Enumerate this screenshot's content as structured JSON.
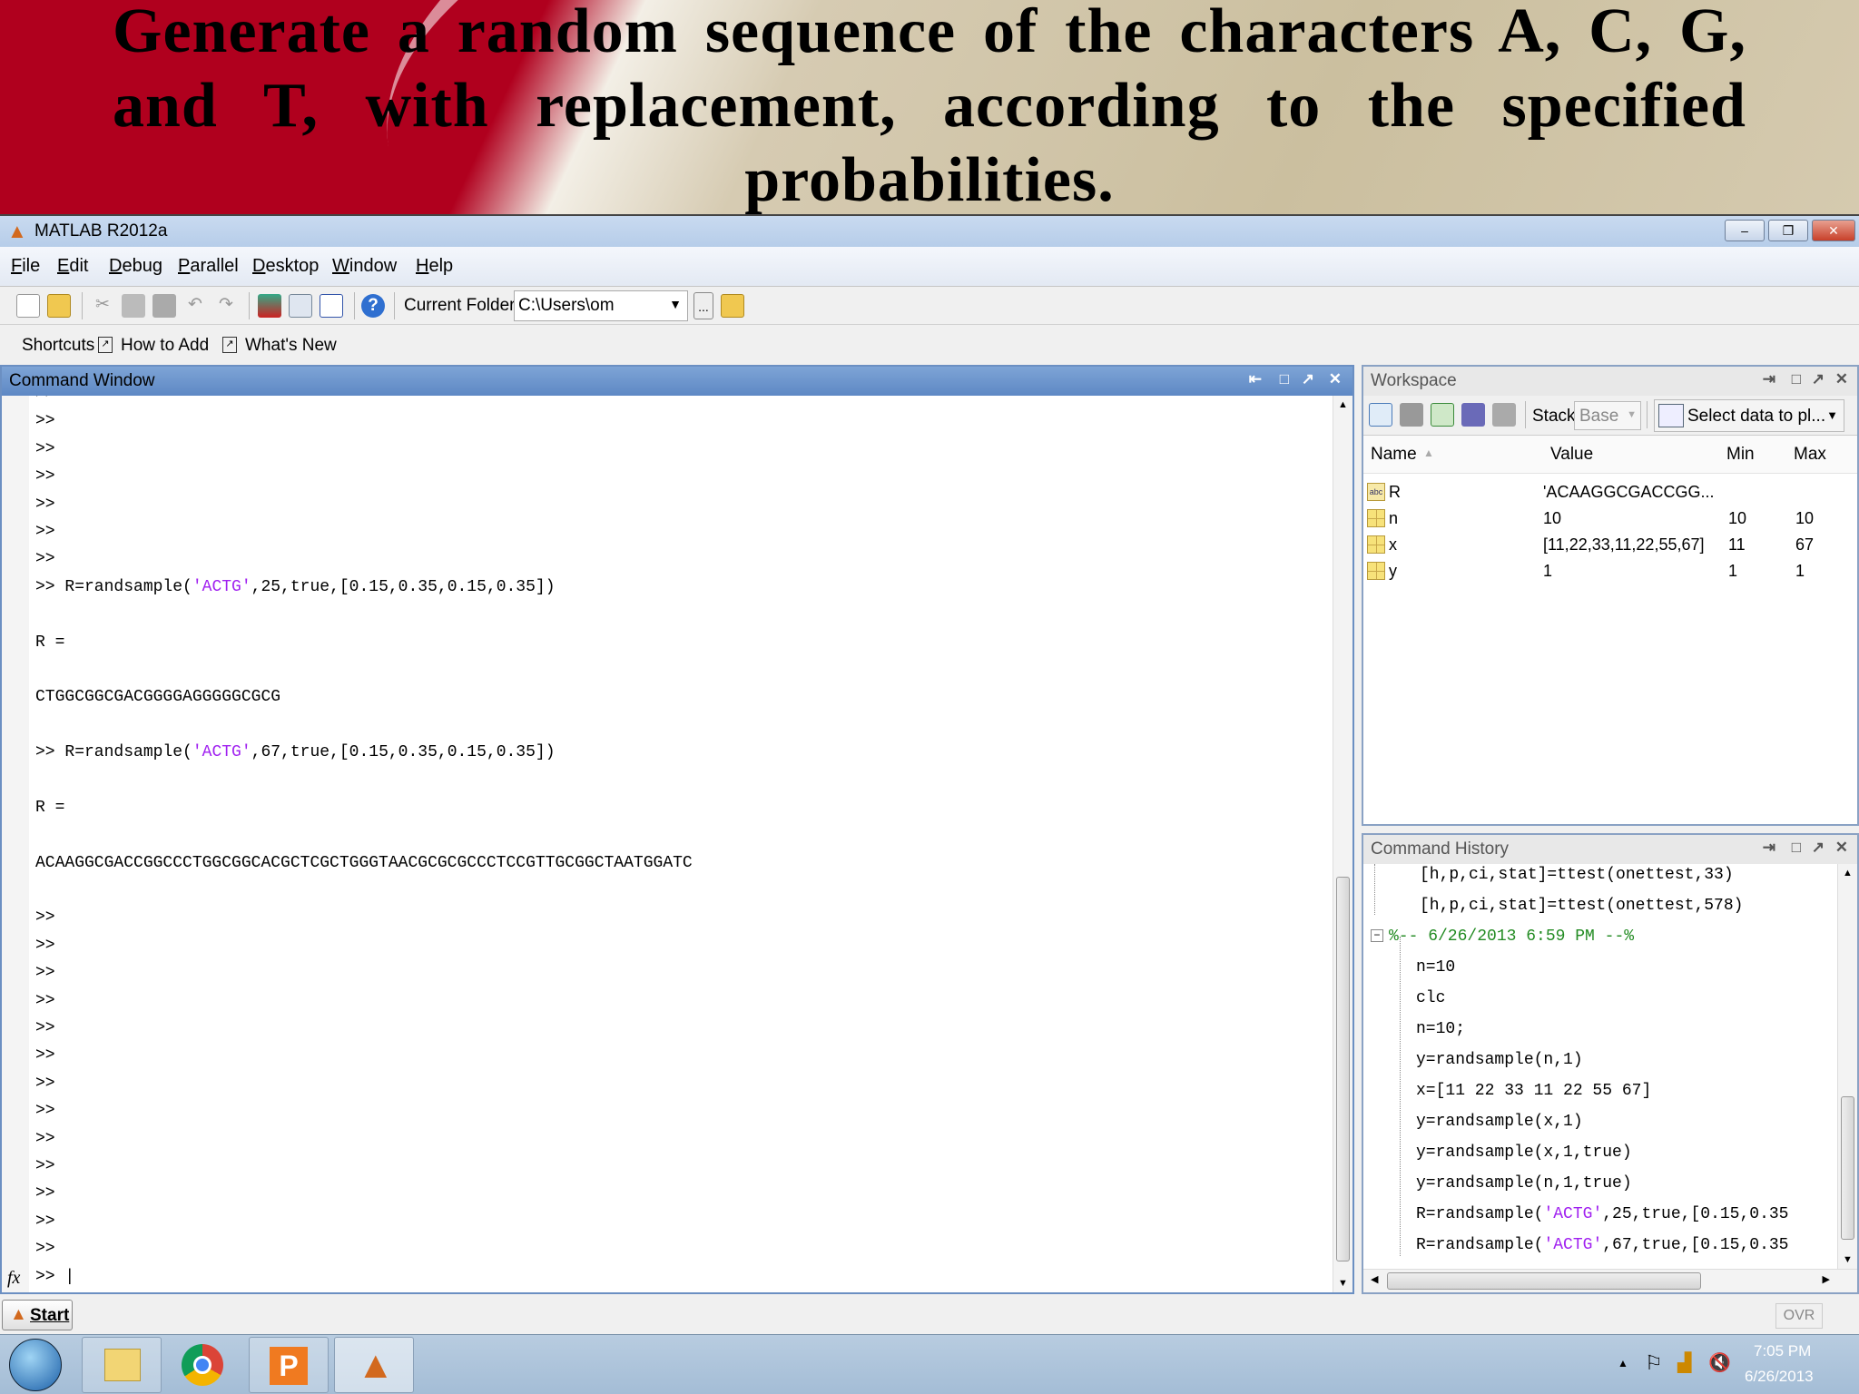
{
  "slide": {
    "title": "Generate a random sequence of the characters A, C, G, and T, with replacement, according to the specified probabilities."
  },
  "window": {
    "title": "MATLAB  R2012a",
    "minimize": "–",
    "restore": "❐",
    "close": "✕"
  },
  "menu": [
    "File",
    "Edit",
    "Debug",
    "Parallel",
    "Desktop",
    "Window",
    "Help"
  ],
  "toolbar": {
    "current_folder_label": "Current Folder:",
    "current_folder_value": "C:\\Users\\om",
    "browse_label": "..."
  },
  "shortcuts": {
    "label": "Shortcuts",
    "items": [
      "How to Add",
      "What's New"
    ]
  },
  "command_window": {
    "title": "Command Window",
    "lines": [
      {
        "p": ">>"
      },
      {
        "p": ">>"
      },
      {
        "p": ">>"
      },
      {
        "p": ">>"
      },
      {
        "p": ">>"
      },
      {
        "p": ">>"
      },
      {
        "p": ">>"
      },
      {
        "p": ">> ",
        "pre": "R=randsample(",
        "str": "'ACTG'",
        "post": ",25,true,[0.15,0.35,0.15,0.35])"
      },
      {
        "pre": ""
      },
      {
        "pre": "R ="
      },
      {
        "pre": ""
      },
      {
        "pre": "CTGGCGGCGACGGGGAGGGGGCGCG"
      },
      {
        "pre": ""
      },
      {
        "p": ">> ",
        "pre": "R=randsample(",
        "str": "'ACTG'",
        "post": ",67,true,[0.15,0.35,0.15,0.35])"
      },
      {
        "pre": ""
      },
      {
        "pre": "R ="
      },
      {
        "pre": ""
      },
      {
        "pre": "ACAAGGCGACCGGCCCTGGCGGCACGCTCGCTGGGTAACGCGCGCCCTCCGTTGCGGCTAATGGATC"
      },
      {
        "pre": ""
      },
      {
        "p": ">>"
      },
      {
        "p": ">>"
      },
      {
        "p": ">>"
      },
      {
        "p": ">>"
      },
      {
        "p": ">>"
      },
      {
        "p": ">>"
      },
      {
        "p": ">>"
      },
      {
        "p": ">>"
      },
      {
        "p": ">>"
      },
      {
        "p": ">>"
      },
      {
        "p": ">>"
      },
      {
        "p": ">>"
      },
      {
        "p": ">>"
      },
      {
        "p": ">> ",
        "pre": "|"
      }
    ],
    "fx_label": "fx"
  },
  "workspace": {
    "title": "Workspace",
    "stack_label": "Stack:",
    "stack_value": "Base",
    "plot_select": "Select data to pl...",
    "columns": [
      "Name",
      "Value",
      "Min",
      "Max"
    ],
    "rows": [
      {
        "type": "char",
        "icon_label": "abc",
        "name": "R",
        "value": "'ACAAGGCGACCGG...",
        "min": "",
        "max": ""
      },
      {
        "type": "double",
        "name": "n",
        "value": "10",
        "min": "10",
        "max": "10"
      },
      {
        "type": "double",
        "name": "x",
        "value": "[11,22,33,11,22,55,67]",
        "min": "11",
        "max": "67"
      },
      {
        "type": "double",
        "name": "y",
        "value": "1",
        "min": "1",
        "max": "1"
      }
    ]
  },
  "history": {
    "title": "Command History",
    "items": [
      {
        "pre": "[h,p,ci,stat]=ttest(onettest,33)"
      },
      {
        "pre": "[h,p,ci,stat]=ttest(onettest,578)"
      },
      {
        "session": "%-- 6/26/2013 6:59 PM --%"
      },
      {
        "pre": "n=10"
      },
      {
        "pre": "clc"
      },
      {
        "pre": "n=10;"
      },
      {
        "pre": "y=randsample(n,1)"
      },
      {
        "pre": "x=[11 22 33 11 22 55 67]"
      },
      {
        "pre": "y=randsample(x,1)"
      },
      {
        "pre": "y=randsample(x,1,true)"
      },
      {
        "pre": "y=randsample(n,1,true)"
      },
      {
        "pre": "R=randsample(",
        "str": "'ACTG'",
        "post": ",25,true,[0.15,0.35"
      },
      {
        "pre": "R=randsample(",
        "str": "'ACTG'",
        "post": ",67,true,[0.15,0.35"
      }
    ]
  },
  "status": {
    "start_label": "Start",
    "ovr": "OVR"
  },
  "taskbar": {
    "time": "7:05 PM",
    "date": "6/26/2013"
  },
  "colors": {
    "string": "#a020f0",
    "session": "#228b22",
    "accent": "#5e88c4",
    "banner": "#b0001e"
  }
}
